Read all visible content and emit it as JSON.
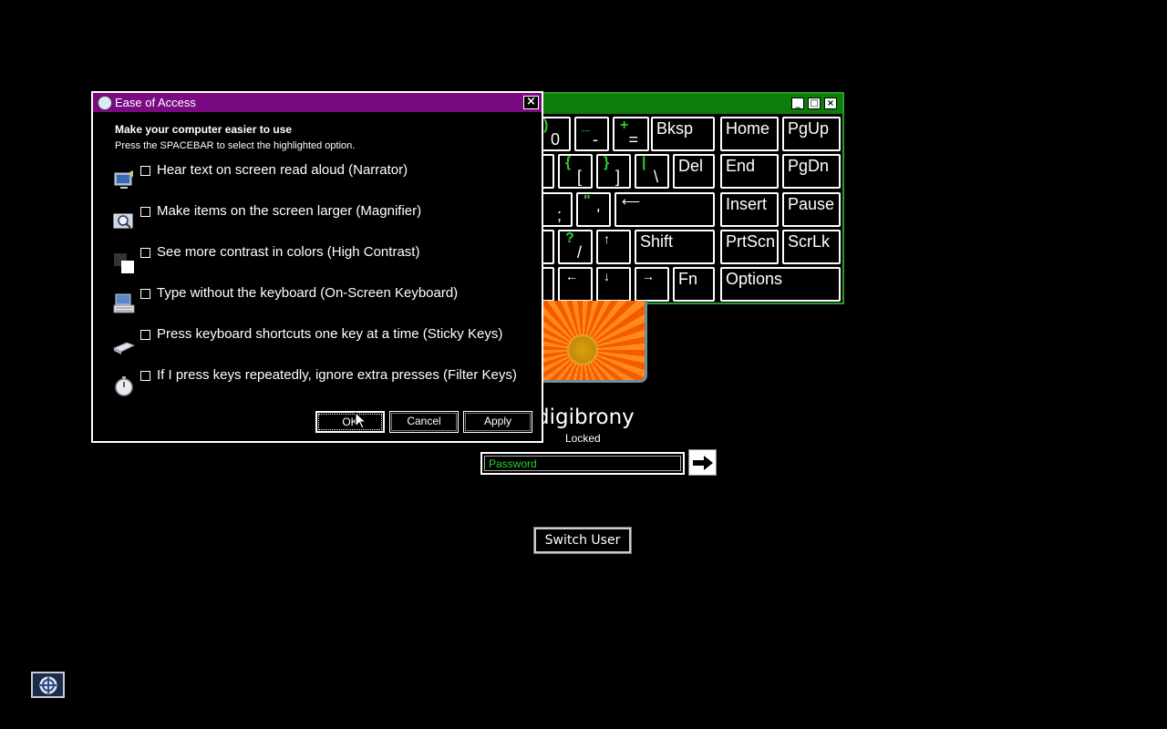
{
  "keyboard": {
    "title_controls": [
      "_",
      "□",
      "×"
    ],
    "keys": {
      "zero": {
        "top": ")",
        "bottom": "0"
      },
      "minus": {
        "top": "_",
        "bottom": "-"
      },
      "plus": {
        "top": "+",
        "bottom": "="
      },
      "bksp": "Bksp",
      "home": "Home",
      "pgup": "PgUp",
      "lbrace": {
        "top": "{",
        "bottom": "["
      },
      "rbrace": {
        "top": "}",
        "bottom": "]"
      },
      "pipe": {
        "top": "|",
        "bottom": "\\"
      },
      "del": "Del",
      "end": "End",
      "pgdn": "PgDn",
      "semicolon": {
        "bottom": ";"
      },
      "quote": {
        "top": "\"",
        "bottom": "'"
      },
      "enter": "⟵",
      "insert": "Insert",
      "pause": "Pause",
      "question": {
        "top": "?",
        "bottom": "/"
      },
      "up": "↑",
      "shift": "Shift",
      "prtscn": "PrtScn",
      "scrlk": "ScrLk",
      "left": "←",
      "down": "↓",
      "right": "→",
      "fn": "Fn",
      "options": "Options"
    }
  },
  "lock": {
    "username": "digibrony",
    "status": "Locked",
    "password_placeholder": "Password",
    "switch_user": "Switch User"
  },
  "dialog": {
    "title": "Ease of Access",
    "close": "×",
    "heading": "Make your computer easier to use",
    "subheading": "Press the SPACEBAR to select the highlighted option.",
    "options": [
      {
        "label": "Hear text on screen read aloud (Narrator)",
        "icon": "narrator-icon",
        "checked": false
      },
      {
        "label": "Make items on the screen larger (Magnifier)",
        "icon": "magnifier-icon",
        "checked": false
      },
      {
        "label": "See more contrast in colors (High Contrast)",
        "icon": "high-contrast-icon",
        "checked": false
      },
      {
        "label": "Type without the keyboard (On-Screen Keyboard)",
        "icon": "keyboard-icon",
        "checked": false
      },
      {
        "label": "Press keyboard shortcuts one key at a time (Sticky Keys)",
        "icon": "sticky-keys-icon",
        "checked": false
      },
      {
        "label": "If I press keys repeatedly, ignore extra presses (Filter Keys)",
        "icon": "stopwatch-icon",
        "checked": false
      }
    ],
    "buttons": {
      "ok": "OK",
      "cancel": "Cancel",
      "apply": "Apply"
    }
  },
  "colors": {
    "dialog_titlebar": "#7a0a82",
    "keyboard_titlebar": "#0b7d0b",
    "key_accent": "#2bd02b"
  }
}
